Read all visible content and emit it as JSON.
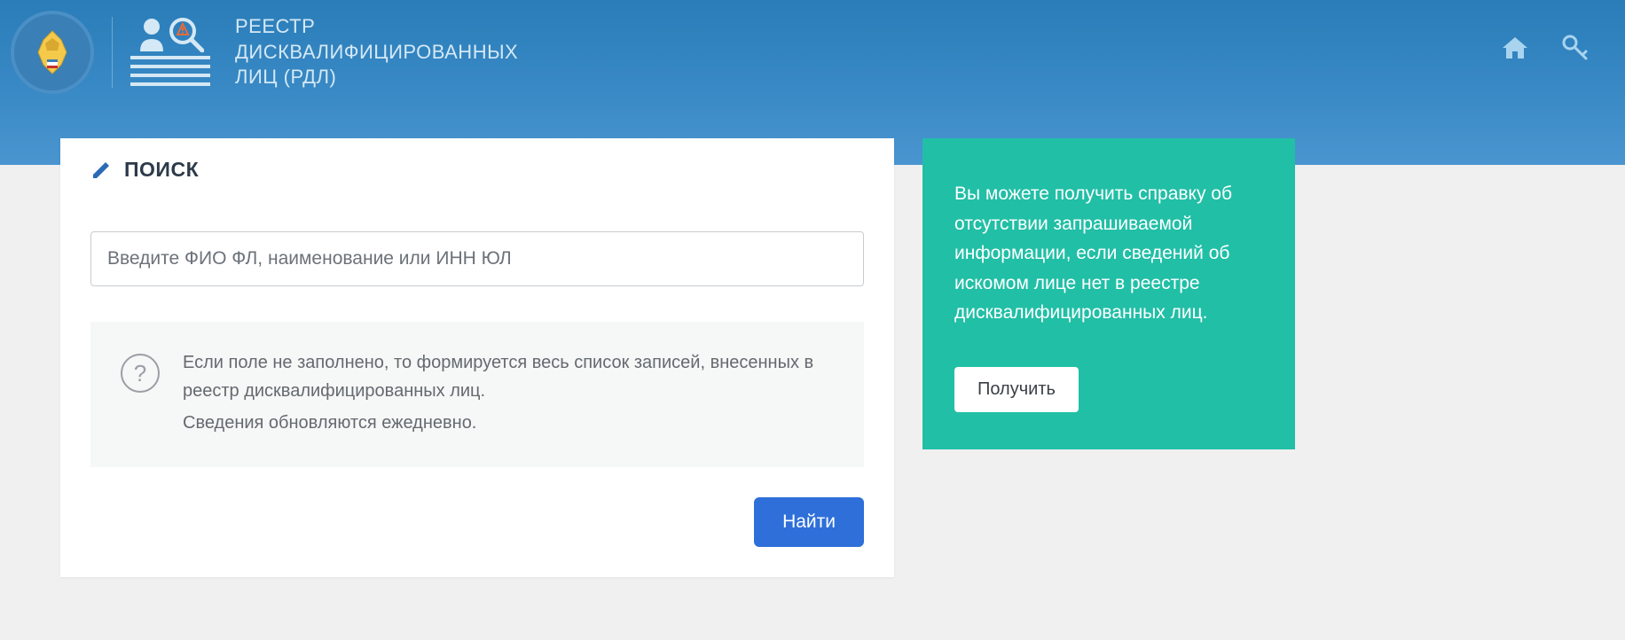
{
  "header": {
    "title_line1": "РЕЕСТР",
    "title_line2": "ДИСКВАЛИФИЦИРОВАННЫХ",
    "title_line3": "ЛИЦ (РДЛ)"
  },
  "search": {
    "heading": "ПОИСК",
    "placeholder": "Введите ФИО ФЛ, наименование или ИНН ЮЛ",
    "hint_line1": "Если поле не заполнено, то формируется весь список записей, внесенных в реестр дисквалифицированных лиц.",
    "hint_line2": "Сведения обновляются ежедневно.",
    "question_mark": "?",
    "submit_label": "Найти"
  },
  "aside": {
    "text": "Вы можете получить справку об отсутствии запрашиваемой информации, если сведений об искомом лице нет в реестре дисквалифицированных лиц.",
    "button_label": "Получить"
  }
}
